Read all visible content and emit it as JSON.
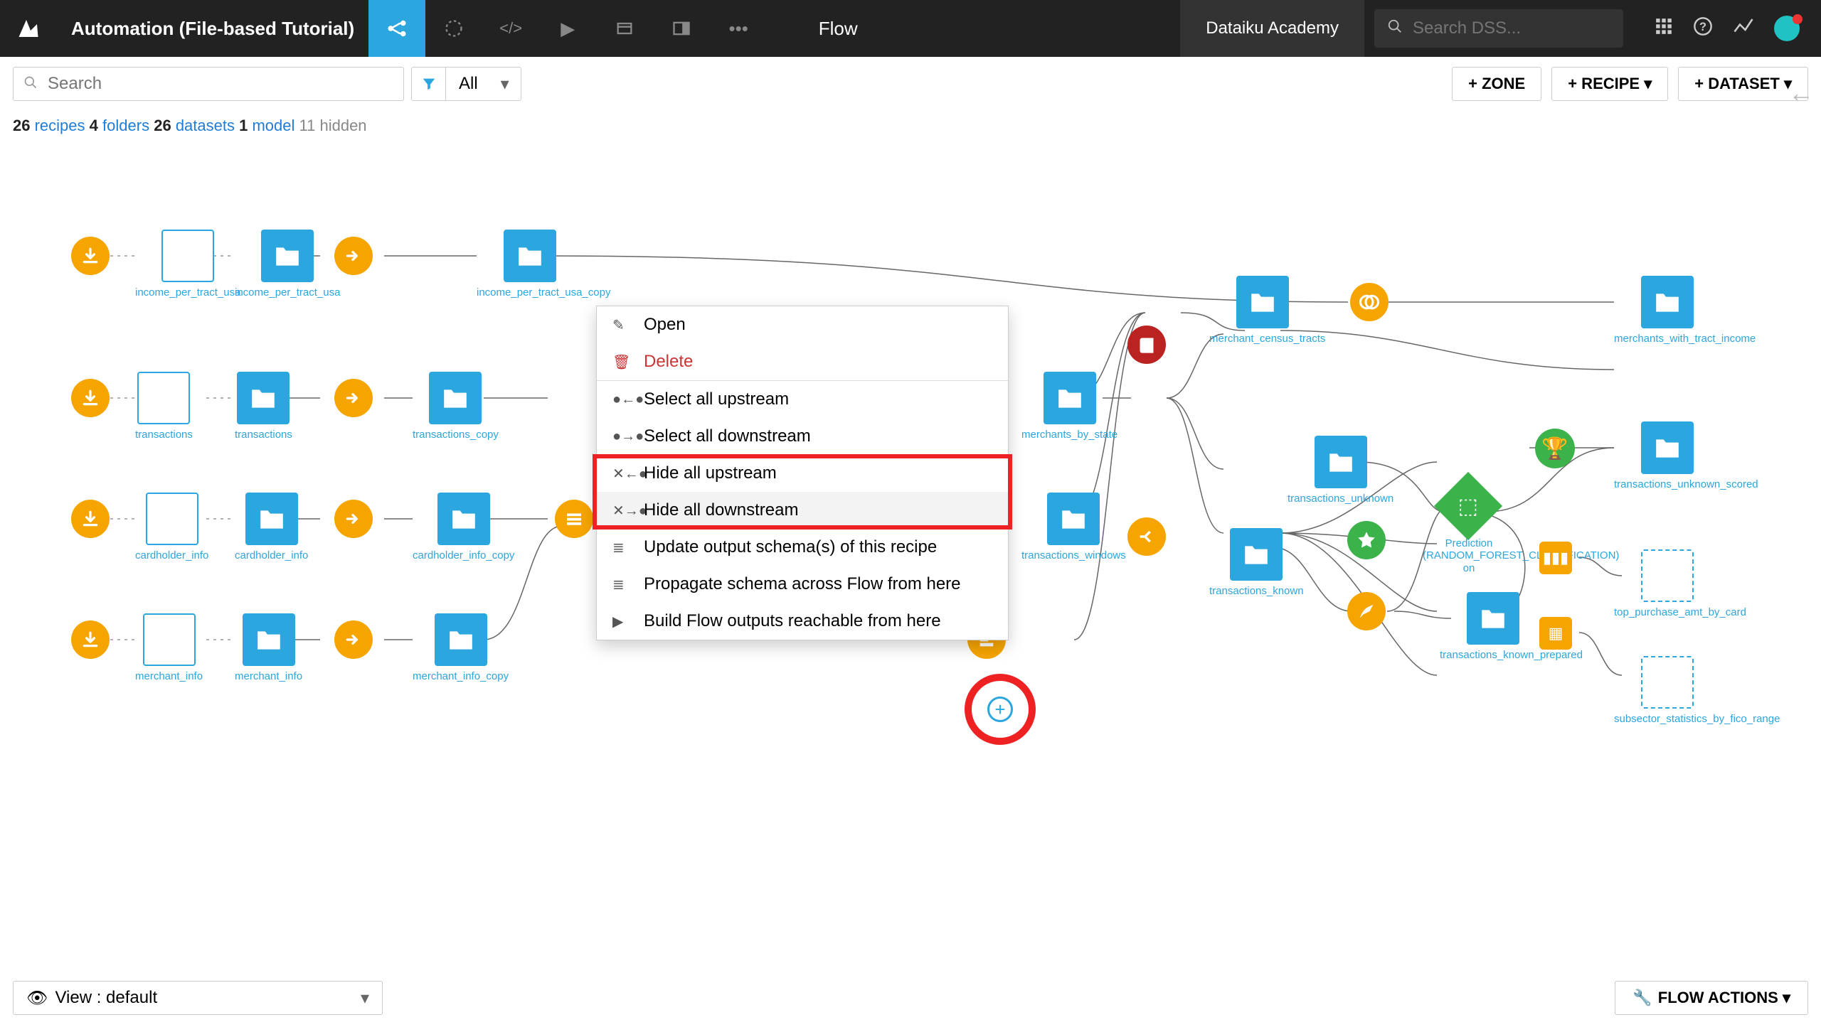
{
  "topbar": {
    "project_name": "Automation (File-based Tutorial)",
    "page_title": "Flow",
    "academy_label": "Dataiku Academy",
    "search_placeholder": "Search DSS..."
  },
  "secbar": {
    "search_placeholder": "Search",
    "filter_value": "All",
    "btn_zone": "+ ZONE",
    "btn_recipe": "+ RECIPE",
    "btn_dataset": "+ DATASET"
  },
  "counts": {
    "recipes_n": "26",
    "recipes_l": "recipes",
    "folders_n": "4",
    "folders_l": "folders",
    "datasets_n": "26",
    "datasets_l": "datasets",
    "model_n": "1",
    "model_l": "model",
    "hidden": "11 hidden"
  },
  "context_menu": {
    "open": "Open",
    "delete": "Delete",
    "sel_up": "Select all upstream",
    "sel_down": "Select all downstream",
    "hide_up": "Hide all upstream",
    "hide_down": "Hide all downstream",
    "update_schema": "Update output schema(s) of this recipe",
    "propagate": "Propagate schema across Flow from here",
    "build": "Build Flow outputs reachable from here"
  },
  "nodes": {
    "income_per_tract_usa_m": "income_per_tract_usa",
    "income_per_tract_usa": "income_per_tract_usa",
    "income_per_tract_usa_copy": "income_per_tract_usa_copy",
    "transactions_m": "transactions",
    "transactions": "transactions",
    "transactions_copy": "transactions_copy",
    "cardholder_info_m": "cardholder_info",
    "cardholder_info": "cardholder_info",
    "cardholder_info_copy": "cardholder_info_copy",
    "merchant_info_m": "merchant_info",
    "merchant_info": "merchant_info",
    "merchant_info_copy": "merchant_info_copy",
    "merchants_by_state": "merchants_by_state",
    "merchant_census_tracts": "merchant_census_tracts",
    "transactions_windows": "transactions_windows",
    "transactions_unknown": "transactions_unknown",
    "transactions_known": "transactions_known",
    "merchants_with_tract_income": "merchants_with_tract_income",
    "transactions_unknown_scored": "transactions_unknown_scored",
    "transactions_known_prepared": "transactions_known_prepared",
    "prediction_label": "Prediction (RANDOM_FOREST_CLASSIFICATION) on",
    "top_purchase": "top_purchase_amt_by_card",
    "subsector": "subsector_statistics_by_fico_range"
  },
  "footer": {
    "view_label": "View : default",
    "flow_actions": "FLOW ACTIONS"
  }
}
